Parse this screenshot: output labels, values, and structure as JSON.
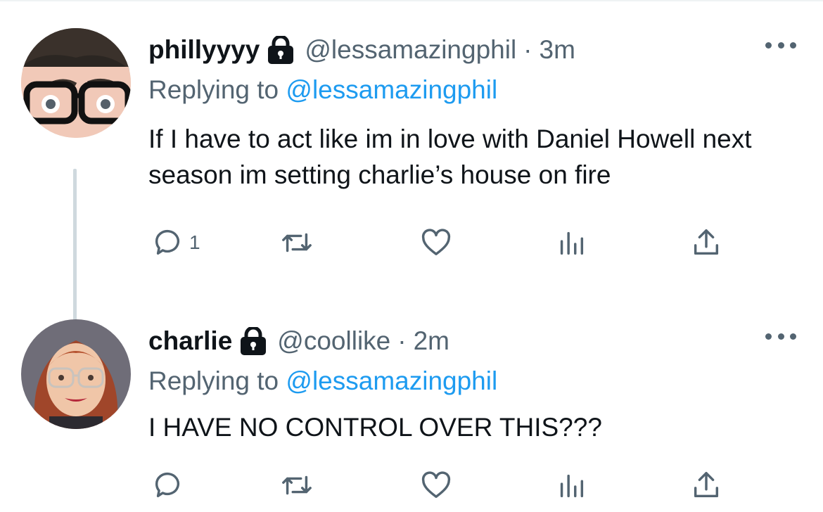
{
  "tweets": [
    {
      "display_name": "phillyyyy",
      "handle": "@lessamazingphil",
      "dot": "·",
      "time": "3m",
      "replying_prefix": "Replying to",
      "replying_to": "@lessamazingphil",
      "text": "If I have to act like im in love with Daniel Howell next season im setting charlie’s house on fire",
      "reply_count": "1",
      "icons": [
        "lock-icon",
        "more-icon",
        "reply-icon",
        "retweet-icon",
        "like-icon",
        "analytics-icon",
        "share-icon"
      ]
    },
    {
      "display_name": "charlie",
      "handle": "@coollike",
      "dot": "·",
      "time": "2m",
      "replying_prefix": "Replying to",
      "replying_to": "@lessamazingphil",
      "text": "I HAVE NO CONTROL OVER THIS???",
      "reply_count": "",
      "icons": [
        "lock-icon",
        "more-icon",
        "reply-icon",
        "retweet-icon",
        "like-icon",
        "analytics-icon",
        "share-icon"
      ]
    }
  ],
  "colors": {
    "text": "#0f1419",
    "secondary": "#536471",
    "link": "#1d9bf0",
    "thread_line": "#cfd9de"
  }
}
